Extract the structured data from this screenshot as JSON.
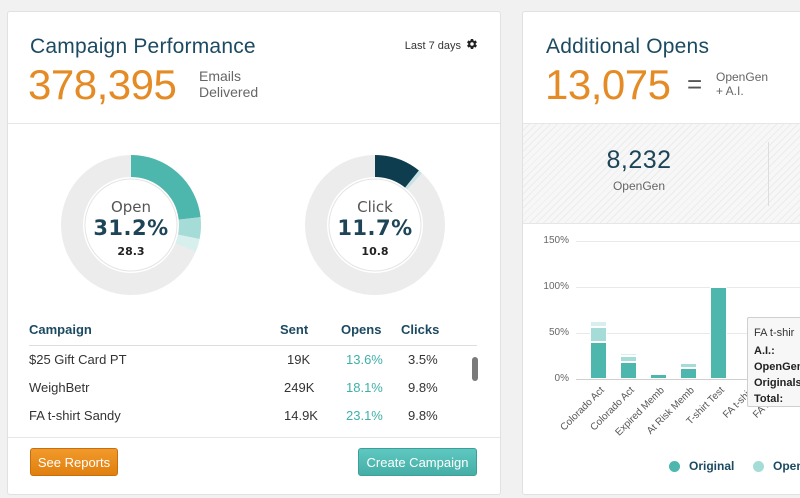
{
  "performance": {
    "title": "Campaign Performance",
    "range_label": "Last 7 days",
    "settings_icon": "gear-icon",
    "emails_delivered": "378,395",
    "emails_caption_1": "Emails",
    "emails_caption_2": "Delivered",
    "open": {
      "label": "Open",
      "percent": "31.2%",
      "sub": "28.3",
      "rate": 0.312,
      "extra": 0.05,
      "extra2": 0.03
    },
    "click": {
      "label": "Click",
      "percent": "11.7%",
      "sub": "10.8",
      "rate": 0.108,
      "extra": 0.009
    },
    "colors": {
      "open": "#4db6ad",
      "open_light": "#a6dcd7",
      "open_lighter": "#d7efed",
      "click": "#0f3d50",
      "click_light": "#c9e2e6",
      "track": "#ececec"
    }
  },
  "campaigns": {
    "headers": {
      "name": "Campaign",
      "sent": "Sent",
      "opens": "Opens",
      "clicks": "Clicks"
    },
    "rows": [
      {
        "name": "$25 Gift Card PT",
        "sent": "19K",
        "opens": "13.6%",
        "clicks": "3.5%"
      },
      {
        "name": "WeighBetr",
        "sent": "249K",
        "opens": "18.1%",
        "clicks": "9.8%"
      },
      {
        "name": "FA t-shirt Sandy",
        "sent": "14.9K",
        "opens": "23.1%",
        "clicks": "9.8%"
      }
    ]
  },
  "buttons": {
    "reports": "See Reports",
    "create": "Create Campaign"
  },
  "additional": {
    "title": "Additional Opens",
    "total": "13,075",
    "equals": "=",
    "caption_1": "OpenGen",
    "caption_2": "+ A.I.",
    "opengen_value": "8,232",
    "opengen_label": "OpenGen"
  },
  "chart_data": {
    "type": "bar",
    "ylabel": "",
    "y_ticks": [
      "150%",
      "100%",
      "50%",
      "0%"
    ],
    "ylim": [
      0,
      150
    ],
    "categories": [
      "Colorado Act",
      "Colorado Act",
      "Expired Memb",
      "At Risk Memb",
      "T-shirt Test",
      "FA t-shirt",
      "FA t-shirt"
    ],
    "series": [
      {
        "name": "Original",
        "values": [
          40,
          18,
          5,
          12,
          100,
          0,
          0
        ],
        "color": "#4db6ad"
      },
      {
        "name": "OpenGen",
        "values": [
          16,
          7,
          2,
          5,
          0,
          0,
          0
        ],
        "color": "#a6dcd7"
      },
      {
        "name": "",
        "values": [
          7,
          3,
          1,
          2,
          0,
          0,
          0
        ],
        "color": "#d7efed"
      }
    ],
    "legend": [
      "Original",
      "Open"
    ],
    "legend_position": "bottom"
  },
  "tooltip": {
    "title": "FA t-shir",
    "rows": [
      "A.I.:",
      "OpenGen",
      "Originals",
      "Total:"
    ]
  }
}
